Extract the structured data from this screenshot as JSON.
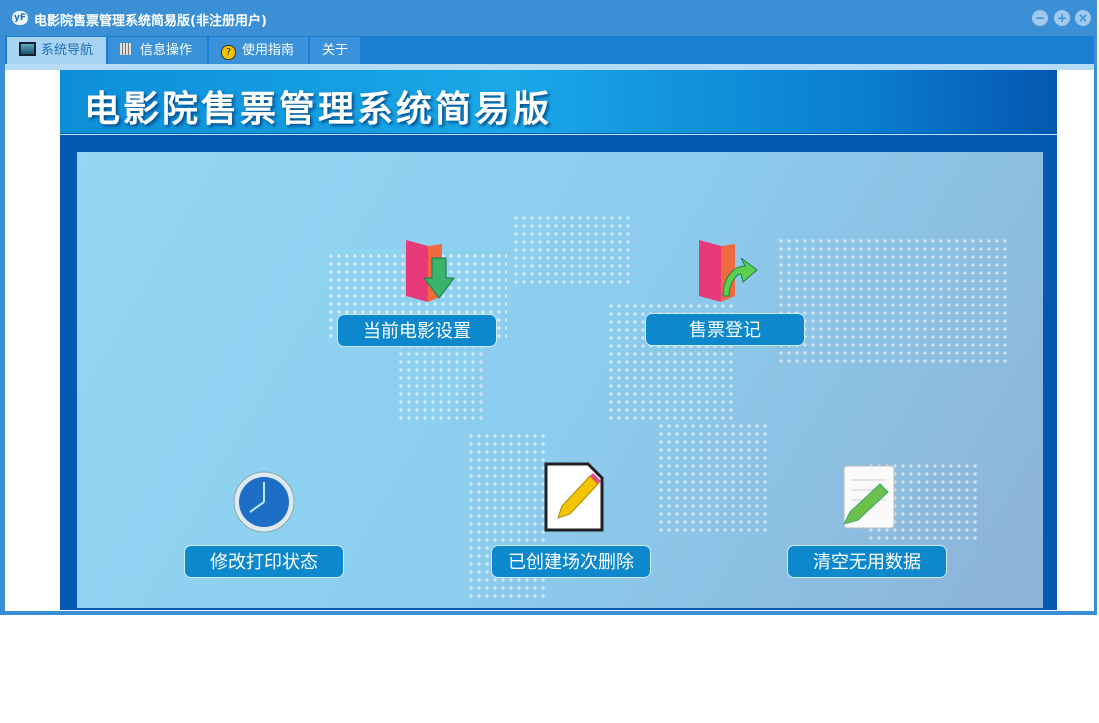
{
  "window": {
    "title": "电影院售票管理系统简易版(非注册用户)",
    "logo": "yF"
  },
  "controls": {
    "minimize": "−",
    "restore": "+",
    "close": "×"
  },
  "tabs": [
    {
      "label": "系统导航",
      "icon": "monitor-icon"
    },
    {
      "label": "信息操作",
      "icon": "grid-icon"
    },
    {
      "label": "使用指南",
      "icon": "help-icon"
    },
    {
      "label": "关于"
    }
  ],
  "banner": {
    "title": "电影院售票管理系统简易版"
  },
  "actions": [
    {
      "label": "当前电影设置",
      "icon": "folder-download-icon"
    },
    {
      "label": "售票登记",
      "icon": "folder-arrow-icon"
    },
    {
      "label": "修改打印状态",
      "icon": "clock-icon"
    },
    {
      "label": "已创建场次删除",
      "icon": "edit-document-icon"
    },
    {
      "label": "清空无用数据",
      "icon": "notepad-pencil-icon"
    }
  ]
}
